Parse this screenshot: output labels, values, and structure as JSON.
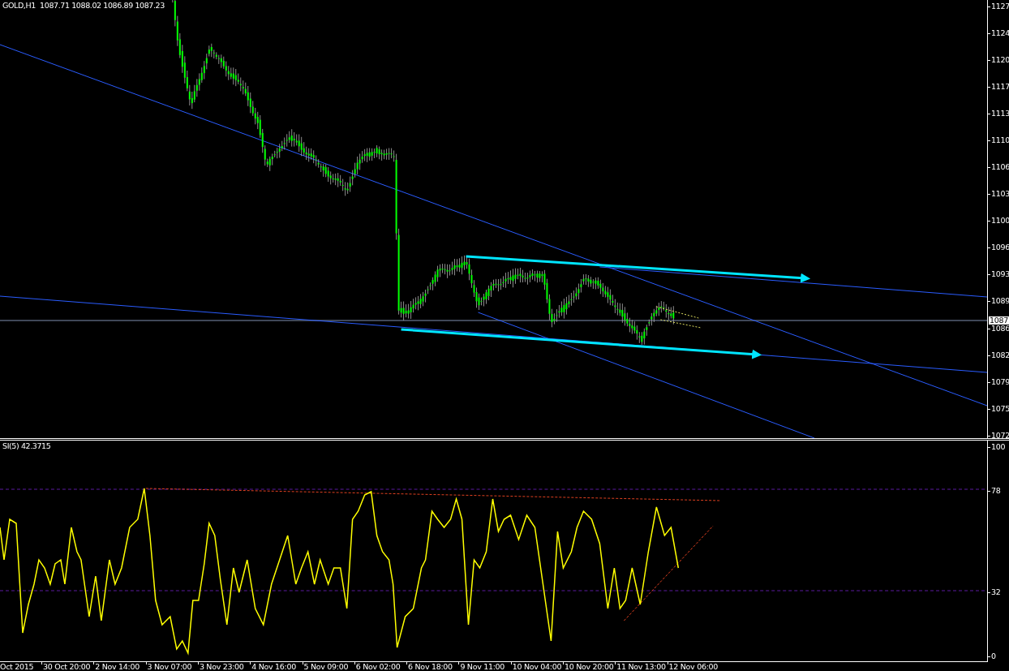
{
  "chart_header": "GOLD,H1  1087.71 1088.02 1086.89 1087.23",
  "price_axis": {
    "labels": [
      "1127",
      "1124",
      "1120",
      "1117",
      "1113",
      "1110",
      "1106",
      "1103",
      "1100",
      "1096",
      "1093",
      "1089",
      "1086",
      "1082",
      "1079",
      "1075",
      "1072"
    ],
    "current_price": "1087"
  },
  "indicator": {
    "label": "SI(5) 42.3715",
    "axis_labels": [
      "100",
      "78",
      "32",
      "0"
    ]
  },
  "time_axis": {
    "labels": [
      "Oct 2015",
      "30 Oct 20:00",
      "2 Nov 14:00",
      "3 Nov 07:00",
      "3 Nov 23:00",
      "4 Nov 16:00",
      "5 Nov 09:00",
      "6 Nov 02:00",
      "6 Nov 18:00",
      "9 Nov 11:00",
      "10 Nov 04:00",
      "10 Nov 20:00",
      "11 Nov 13:00",
      "12 Nov 06:00"
    ]
  }
}
